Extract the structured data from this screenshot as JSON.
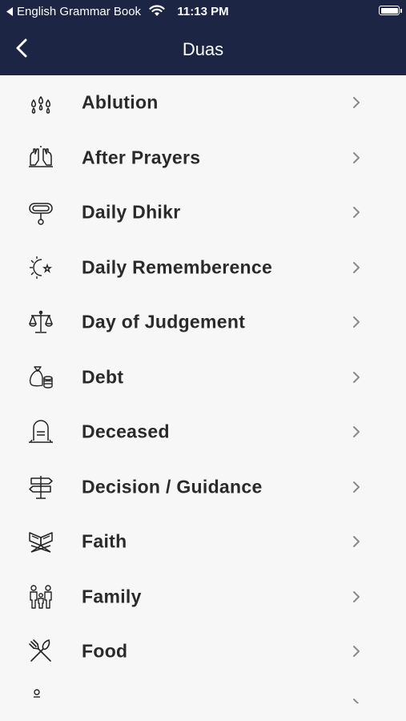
{
  "status_bar": {
    "back_app_label": "English Grammar Book",
    "time": "11:13 PM",
    "icons": [
      "back-arrow-icon",
      "wifi-icon",
      "battery-icon"
    ]
  },
  "nav": {
    "title": "Duas",
    "back_icon": "chevron-left-icon"
  },
  "colors": {
    "header_bg": "#1c2644",
    "page_bg": "#f7f7f7",
    "text": "#2a2a2a",
    "chevron": "#8a8a8a"
  },
  "list": {
    "items": [
      {
        "label": "Ablution",
        "icon": "water-drops-icon"
      },
      {
        "label": "After Prayers",
        "icon": "praying-hands-icon"
      },
      {
        "label": "Daily Dhikr",
        "icon": "prayer-beads-icon"
      },
      {
        "label": "Daily Rememberence",
        "icon": "sun-moon-icon"
      },
      {
        "label": "Day of Judgement",
        "icon": "scales-icon"
      },
      {
        "label": "Debt",
        "icon": "money-bag-icon"
      },
      {
        "label": "Deceased",
        "icon": "gravestone-icon"
      },
      {
        "label": "Decision / Guidance",
        "icon": "signpost-icon"
      },
      {
        "label": "Faith",
        "icon": "quran-stand-icon"
      },
      {
        "label": "Family",
        "icon": "family-icon"
      },
      {
        "label": "Food",
        "icon": "fork-knife-icon"
      }
    ],
    "chevron_icon": "chevron-right-icon"
  }
}
